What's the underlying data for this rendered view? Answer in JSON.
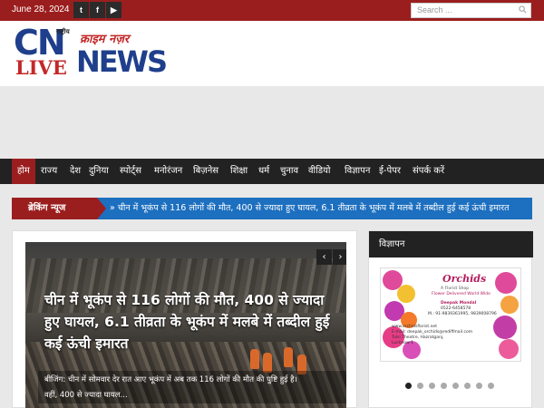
{
  "topbar": {
    "date": "June 28, 2024",
    "social": [
      "twitter-icon",
      "facebook-icon",
      "youtube-icon"
    ],
    "search_placeholder": "Search ..."
  },
  "logo": {
    "cn": "CN",
    "live": "LIVE",
    "news": "NEWS",
    "rashtriya": "राष्ट्रीय",
    "crime": "क्राइम नज़र"
  },
  "nav": {
    "items": [
      "होम",
      "राज्य",
      "देश",
      "दुनिया",
      "स्पोर्ट्स",
      "मनोरंजन",
      "बिज़नेस",
      "शिक्षा",
      "धर्म",
      "चुनाव",
      "वीडियो",
      "विज्ञापन",
      "ई-पेपर",
      "संपर्क करें"
    ],
    "active_index": 0
  },
  "breaking": {
    "label": "ब्रेकिंग न्यूज",
    "bullet": "»",
    "text": "चीन में भूकंप से 116 लोगों की मौत, 400 से ज्यादा हुए घायल, 6.1 तीव्रता के भूकंप में मलबे में तब्दील हुई कई ऊंची इमारत"
  },
  "slider": {
    "title": "चीन में भूकंप से 116 लोगों की मौत, 400 से ज्यादा हुए घायल, 6.1 तीव्रता के भूकंप में मलबे में तब्दील हुई कई ऊंची इमारत",
    "excerpt_line1": "बीजिंग: चीन में सोमवार देर रात आए भूकंप में अब तक 116 लोगों की मौत की पुष्टि हुई है।",
    "excerpt_line2": "वहीं, 400 से ज्यादा घायल...",
    "prev": "‹",
    "next": "›"
  },
  "sidebar": {
    "heading": "विज्ञापन",
    "ad": {
      "name": "Orchids",
      "tagline": "A Florist Shop",
      "subtag": "Flower Delivered World Wide",
      "contact": "Deepak Mondal",
      "phone1": "0522-6458578",
      "phone2": "M.: 91-9839361995, 9839008796",
      "web": "www.orchidsflorist.net",
      "email": "E-mail: deepak_orchids@rediffmail.com",
      "addr1": "Tulsi Theatre, Hazratganj,",
      "addr2": "Lucknow-1"
    },
    "dots": 8,
    "active_dot": 0
  },
  "colors": {
    "brand_red": "#9b1e1e",
    "breaking_blue": "#1d6fbf",
    "nav_dark": "#222222",
    "logo_blue": "#1f3f8c"
  }
}
